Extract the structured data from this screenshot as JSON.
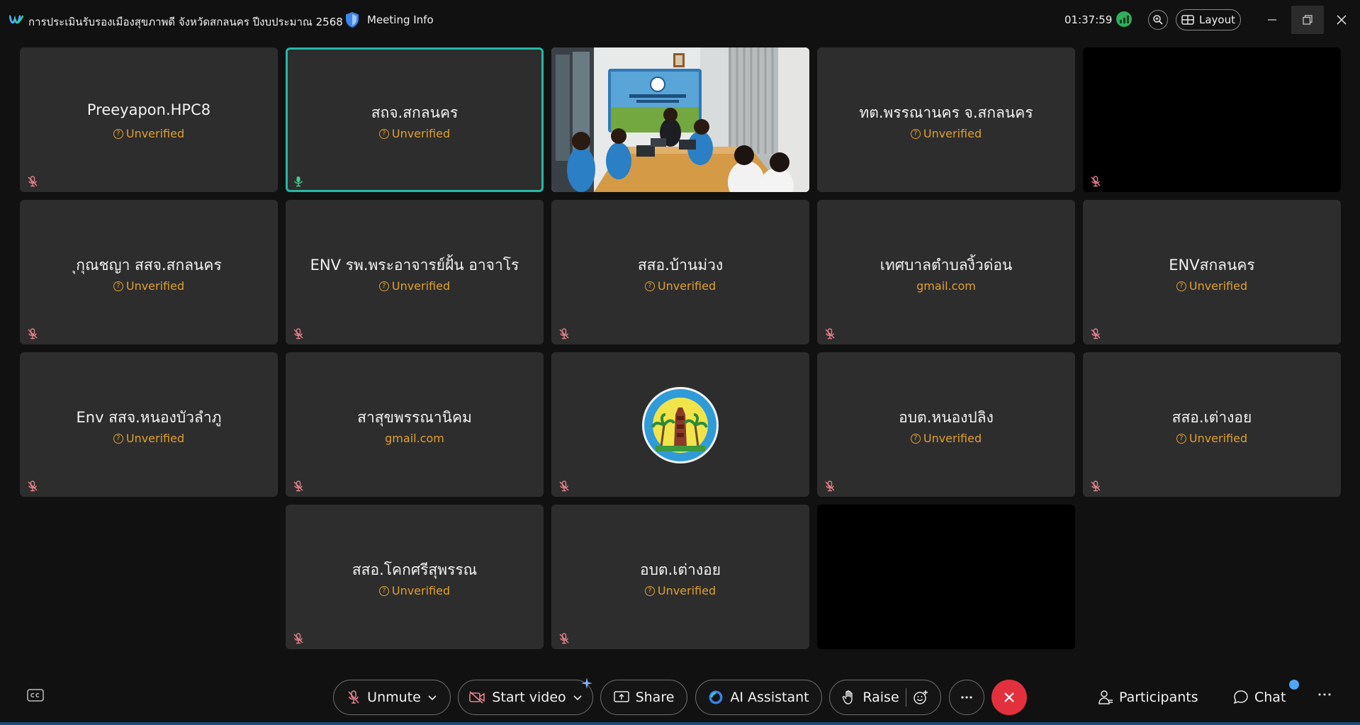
{
  "titlebar": {
    "meeting_title": "การประเมินรับรองเมืองสุขภาพดี จังหวัดสกลนคร ปีงบประมาณ 2568",
    "meeting_info": "Meeting Info",
    "clock": "01:37:59",
    "layout_label": "Layout"
  },
  "tiles": [
    {
      "name": "Preeyapon.HPC8",
      "status": "Unverified"
    },
    {
      "name": "สถจ.สกลนคร",
      "status": "Unverified"
    },
    {
      "name": "ทต.พรรณานคร จ.สกลนคร",
      "status": "Unverified"
    },
    {
      "name": "ุกุณชญา สสจ.สกลนคร",
      "status": "Unverified"
    },
    {
      "name": "ENV รพ.พระอาจารย์ฝั้น อาจาโร",
      "status": "Unverified"
    },
    {
      "name": "สสอ.บ้านม่วง",
      "status": "Unverified"
    },
    {
      "name": "เทศบาลตำบลงิ้วด่อน",
      "status": "gmail.com"
    },
    {
      "name": "ENVสกลนคร",
      "status": "Unverified"
    },
    {
      "name": "Env สสจ.หนองบัวลำภู",
      "status": "Unverified"
    },
    {
      "name": "สาสุขพรรณานิคม",
      "status": "gmail.com"
    },
    {
      "name": "อบต.หนองปลิง",
      "status": "Unverified"
    },
    {
      "name": "สสอ.เต่างอย",
      "status": "Unverified"
    },
    {
      "name": "สสอ.โคกศรีสุพรรณ",
      "status": "Unverified"
    },
    {
      "name": "อบต.เต่างอย",
      "status": "Unverified"
    }
  ],
  "toolbar": {
    "unmute": "Unmute",
    "start_video": "Start video",
    "share": "Share",
    "ai_assistant": "AI Assistant",
    "raise": "Raise",
    "participants": "Participants",
    "chat": "Chat"
  },
  "colors": {
    "active_border": "#25b8a5",
    "unverified": "#e0a030",
    "end_call": "#e2313d",
    "mute_icon": "#e6808c"
  }
}
